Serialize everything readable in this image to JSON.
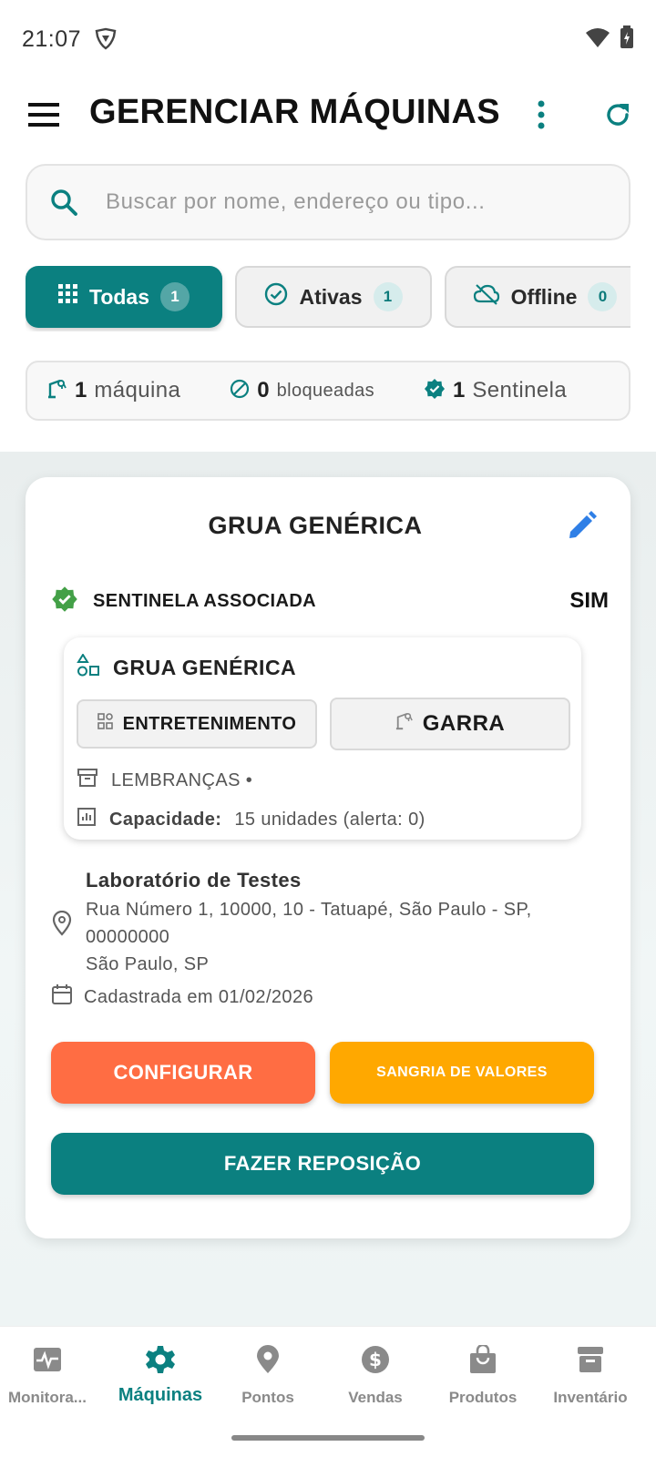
{
  "status_bar": {
    "time": "21:07"
  },
  "app_bar": {
    "title": "GERENCIAR MÁQUINAS"
  },
  "search": {
    "placeholder": "Buscar por nome, endereço ou tipo..."
  },
  "filters": [
    {
      "label": "Todas",
      "count": "1",
      "active": true
    },
    {
      "label": "Ativas",
      "count": "1",
      "active": false
    },
    {
      "label": "Offline",
      "count": "0",
      "active": false
    }
  ],
  "summary": {
    "machines_count": "1",
    "machines_label": "máquina",
    "blocked_count": "0",
    "blocked_label": "bloqueadas",
    "sentinel_count": "1",
    "sentinel_label": "Sentinela"
  },
  "machine_card": {
    "title": "GRUA GENÉRICA",
    "sentinel_label": "SENTINELA ASSOCIADA",
    "sentinel_value": "SIM",
    "type": {
      "name": "GRUA GENÉRICA",
      "category": "ENTRETENIMENTO",
      "kind": "GARRA",
      "product_line": "LEMBRANÇAS •",
      "capacity_label": "Capacidade:",
      "capacity_value": "15 unidades (alerta: 0)"
    },
    "location": {
      "name": "Laboratório de Testes",
      "address_line1": "Rua Número 1, 10000, 10 - Tatuapé, São Paulo - SP,",
      "address_line2": "00000000",
      "city": "São Paulo, SP"
    },
    "registered": "Cadastrada em 01/02/2026",
    "buttons": {
      "configure": "CONFIGURAR",
      "sangria": "SANGRIA DE VALORES",
      "restock": "FAZER REPOSIÇÃO"
    }
  },
  "bottom_nav": [
    {
      "label": "Monitora...",
      "icon": "monitor-icon",
      "active": false
    },
    {
      "label": "Máquinas",
      "icon": "gear-icon",
      "active": true
    },
    {
      "label": "Pontos",
      "icon": "location-pin-icon",
      "active": false
    },
    {
      "label": "Vendas",
      "icon": "dollar-icon",
      "active": false
    },
    {
      "label": "Produtos",
      "icon": "shopping-bag-icon",
      "active": false
    },
    {
      "label": "Inventário",
      "icon": "archive-icon",
      "active": false
    }
  ],
  "colors": {
    "primary": "#0b8080",
    "configure": "#ff6d43",
    "sangria": "#ffa800",
    "sentinel_green": "#43a047",
    "edit_blue": "#2f7fe6"
  }
}
